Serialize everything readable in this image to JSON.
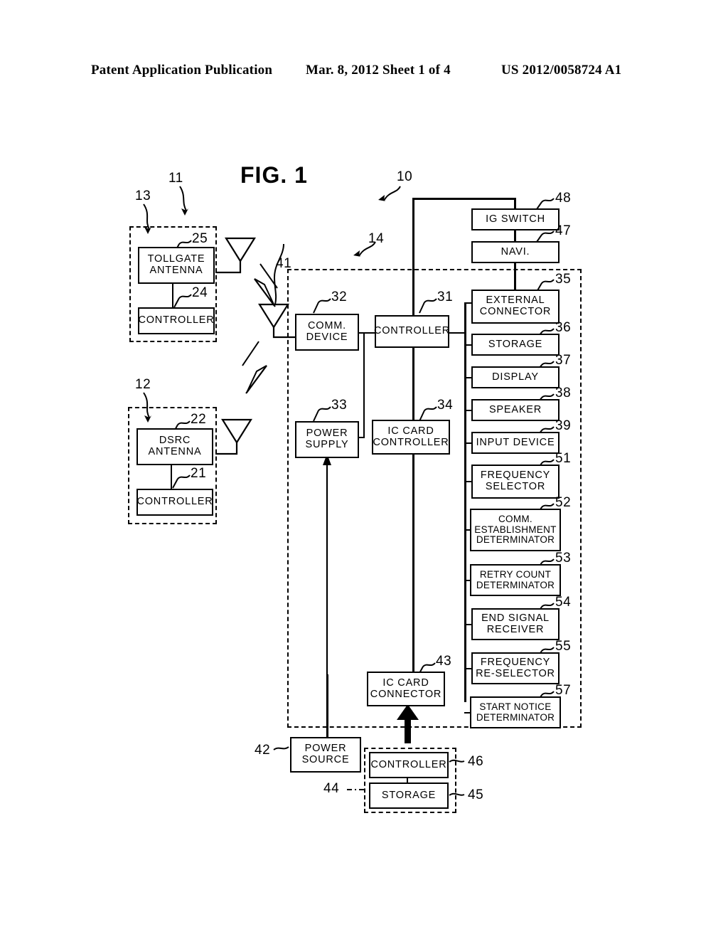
{
  "header": {
    "left": "Patent Application Publication",
    "middle": "Mar. 8, 2012   Sheet 1 of 4",
    "right": "US 2012/0058724 A1"
  },
  "figure": {
    "title": "FIG. 1"
  },
  "blocks": {
    "tollgate_antenna": "TOLLGATE\nANTENNA",
    "tollgate_controller": "CONTROLLER",
    "dsrc_antenna": "DSRC\nANTENNA",
    "dsrc_controller": "CONTROLLER",
    "comm_device": "COMM.\nDEVICE",
    "power_supply": "POWER\nSUPPLY",
    "controller": "CONTROLLER",
    "ic_card_controller": "IC CARD\nCONTROLLER",
    "ic_card_connector": "IC CARD\nCONNECTOR",
    "ig_switch": "IG SWITCH",
    "navi": "NAVI.",
    "external_connector": "EXTERNAL\nCONNECTOR",
    "storage": "STORAGE",
    "display": "DISPLAY",
    "speaker": "SPEAKER",
    "input_device": "INPUT DEVICE",
    "frequency_selector": "FREQUENCY\nSELECTOR",
    "comm_establishment_determinator": "COMM.\nESTABLISHMENT\nDETERMINATOR",
    "retry_count_determinator": "RETRY COUNT\nDETERMINATOR",
    "end_signal_receiver": "END SIGNAL\nRECEIVER",
    "frequency_reselector": "FREQUENCY\nRE-SELECTOR",
    "start_notice_determinator": "START NOTICE\nDETERMINATOR",
    "power_source": "POWER\nSOURCE",
    "card_controller": "CONTROLLER",
    "card_storage": "STORAGE"
  },
  "refs": {
    "r10": "10",
    "r11": "11",
    "r12": "12",
    "r13": "13",
    "r14": "14",
    "r21": "21",
    "r22": "22",
    "r24": "24",
    "r25": "25",
    "r31": "31",
    "r32": "32",
    "r33": "33",
    "r34": "34",
    "r35": "35",
    "r36": "36",
    "r37": "37",
    "r38": "38",
    "r39": "39",
    "r41": "41",
    "r42": "42",
    "r43": "43",
    "r44": "44",
    "r45": "45",
    "r46": "46",
    "r47": "47",
    "r48": "48",
    "r51": "51",
    "r52": "52",
    "r53": "53",
    "r54": "54",
    "r55": "55",
    "r57": "57"
  }
}
